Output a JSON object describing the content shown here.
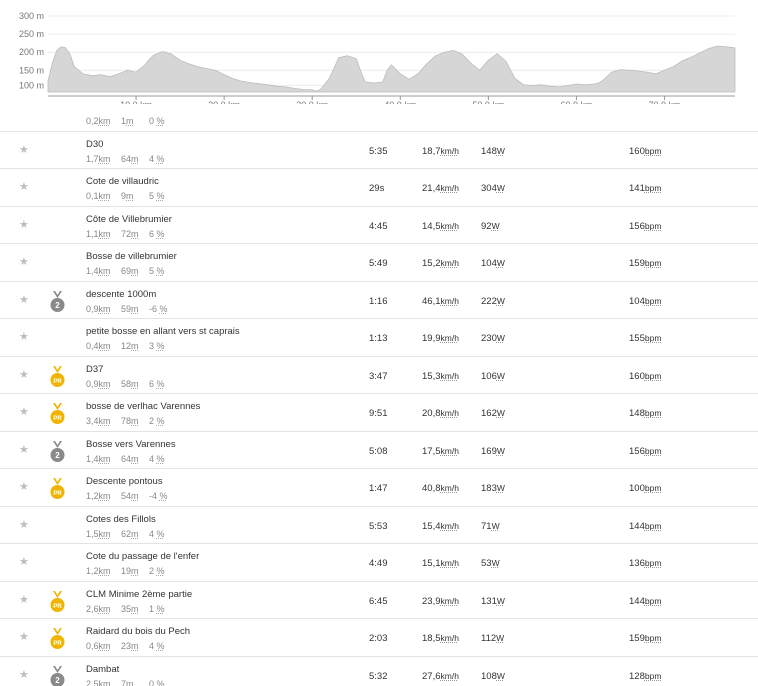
{
  "chart_data": {
    "type": "area",
    "y_ticks": [
      "300 m",
      "250 m",
      "200 m",
      "150 m",
      "100 m"
    ],
    "ylim": [
      90,
      300
    ],
    "x_ticks": [
      {
        "km": 10,
        "label": "10,0 km"
      },
      {
        "km": 20,
        "label": "20,0 km"
      },
      {
        "km": 30,
        "label": "30,0 km"
      },
      {
        "km": 40,
        "label": "40,0 km"
      },
      {
        "km": 50,
        "label": "50,0 km"
      },
      {
        "km": 60,
        "label": "60,0 km"
      },
      {
        "km": 70,
        "label": "70,0 km"
      }
    ],
    "xlim": [
      0,
      78
    ],
    "x": [
      0,
      0.5,
      1,
      1.5,
      2,
      2.5,
      3,
      4,
      5,
      6,
      7,
      8,
      9,
      10,
      11,
      11.5,
      12,
      13,
      14,
      15,
      16,
      17,
      18,
      19,
      20,
      21,
      22,
      23,
      24,
      25,
      26,
      27,
      28,
      29,
      30,
      30.5,
      31,
      32,
      33,
      34,
      35,
      35.5,
      36,
      37,
      38,
      38.5,
      39,
      40,
      41,
      42,
      43,
      44,
      45,
      46,
      47,
      48,
      49,
      50,
      51,
      52,
      53,
      54,
      55,
      56,
      57,
      58,
      59,
      60,
      61,
      62,
      62.5,
      63,
      64,
      65,
      66,
      67,
      68,
      69,
      70,
      71,
      72,
      73,
      74,
      75,
      76,
      77,
      78
    ],
    "values": [
      120,
      170,
      205,
      215,
      212,
      195,
      160,
      140,
      135,
      138,
      132,
      140,
      150,
      145,
      165,
      180,
      192,
      202,
      195,
      178,
      168,
      160,
      155,
      150,
      138,
      127,
      120,
      116,
      113,
      110,
      106,
      104,
      100,
      97,
      96,
      92,
      98,
      130,
      185,
      190,
      182,
      148,
      118,
      115,
      118,
      150,
      165,
      140,
      125,
      140,
      168,
      190,
      200,
      205,
      195,
      170,
      150,
      178,
      196,
      175,
      128,
      110,
      108,
      110,
      106,
      104,
      108,
      112,
      110,
      112,
      115,
      122,
      145,
      152,
      150,
      148,
      145,
      140,
      150,
      160,
      176,
      186,
      198,
      210,
      217,
      215,
      212,
      210,
      192
    ],
    "grid": true
  },
  "rows": [
    {
      "name": "",
      "len": "0,2",
      "elev": "1",
      "grade": "0",
      "time": "",
      "speed": "",
      "power": "",
      "hr": "",
      "medal": "none"
    },
    {
      "name": "D30",
      "len": "1,7",
      "elev": "64",
      "grade": "4",
      "time": "5:35",
      "speed": "18,7",
      "power": "148",
      "hr": "160",
      "medal": "none"
    },
    {
      "name": "Cote de villaudric",
      "len": "0,1",
      "elev": "9",
      "grade": "5",
      "time": "29s",
      "speed": "21,4",
      "power": "304",
      "hr": "141",
      "medal": "none"
    },
    {
      "name": "Côte de Villebrumier",
      "len": "1,1",
      "elev": "72",
      "grade": "6",
      "time": "4:45",
      "speed": "14,5",
      "power": "92",
      "hr": "156",
      "medal": "none"
    },
    {
      "name": "Bosse de villebrumier",
      "len": "1,4",
      "elev": "69",
      "grade": "5",
      "time": "5:49",
      "speed": "15,2",
      "power": "104",
      "hr": "159",
      "medal": "none"
    },
    {
      "name": "descente 1000m",
      "len": "0,9",
      "elev": "59",
      "grade": "-6",
      "time": "1:16",
      "speed": "46,1",
      "power": "222",
      "hr": "104",
      "medal": "silver",
      "medal_text": "2"
    },
    {
      "name": "petite bosse en allant vers st caprais",
      "len": "0,4",
      "elev": "12",
      "grade": "3",
      "time": "1:13",
      "speed": "19,9",
      "power": "230",
      "hr": "155",
      "medal": "none"
    },
    {
      "name": "D37",
      "len": "0,9",
      "elev": "58",
      "grade": "6",
      "time": "3:47",
      "speed": "15,3",
      "power": "106",
      "hr": "160",
      "medal": "pr",
      "medal_text": "PR"
    },
    {
      "name": "bosse de verlhac Varennes",
      "len": "3,4",
      "elev": "78",
      "grade": "2",
      "time": "9:51",
      "speed": "20,8",
      "power": "162",
      "hr": "148",
      "medal": "pr",
      "medal_text": "PR"
    },
    {
      "name": "Bosse vers Varennes",
      "len": "1,4",
      "elev": "64",
      "grade": "4",
      "time": "5:08",
      "speed": "17,5",
      "power": "169",
      "hr": "156",
      "medal": "silver",
      "medal_text": "2"
    },
    {
      "name": "Descente pontous",
      "len": "1,2",
      "elev": "54",
      "grade": "-4",
      "time": "1:47",
      "speed": "40,8",
      "power": "183",
      "hr": "100",
      "medal": "pr",
      "medal_text": "PR"
    },
    {
      "name": "Cotes des Fillols",
      "len": "1,5",
      "elev": "62",
      "grade": "4",
      "time": "5:53",
      "speed": "15,4",
      "power": "71",
      "hr": "144",
      "medal": "none"
    },
    {
      "name": "Cote du passage de l'enfer",
      "len": "1,2",
      "elev": "19",
      "grade": "2",
      "time": "4:49",
      "speed": "15,1",
      "power": "53",
      "hr": "136",
      "medal": "none"
    },
    {
      "name": "CLM Minime 2ème partie",
      "len": "2,6",
      "elev": "35",
      "grade": "1",
      "time": "6:45",
      "speed": "23,9",
      "power": "131",
      "hr": "144",
      "medal": "pr",
      "medal_text": "PR"
    },
    {
      "name": "Raidard du bois du Pech",
      "len": "0,6",
      "elev": "23",
      "grade": "4",
      "time": "2:03",
      "speed": "18,5",
      "power": "112",
      "hr": "159",
      "medal": "pr",
      "medal_text": "PR"
    },
    {
      "name": "Dambat",
      "len": "2,5",
      "elev": "7",
      "grade": "0",
      "time": "5:32",
      "speed": "27,6",
      "power": "108",
      "hr": "128",
      "medal": "silver",
      "medal_text": "2"
    }
  ],
  "units": {
    "km": "km",
    "m": "m",
    "pct": "%",
    "kmh": "km/h",
    "w": "W",
    "bpm": "bpm"
  },
  "star_glyph": "★",
  "colors": {
    "gold": "#f0b400",
    "silver": "#8a8a8a",
    "area": "#d6d6d6",
    "area_stroke": "#bdbdbd"
  }
}
